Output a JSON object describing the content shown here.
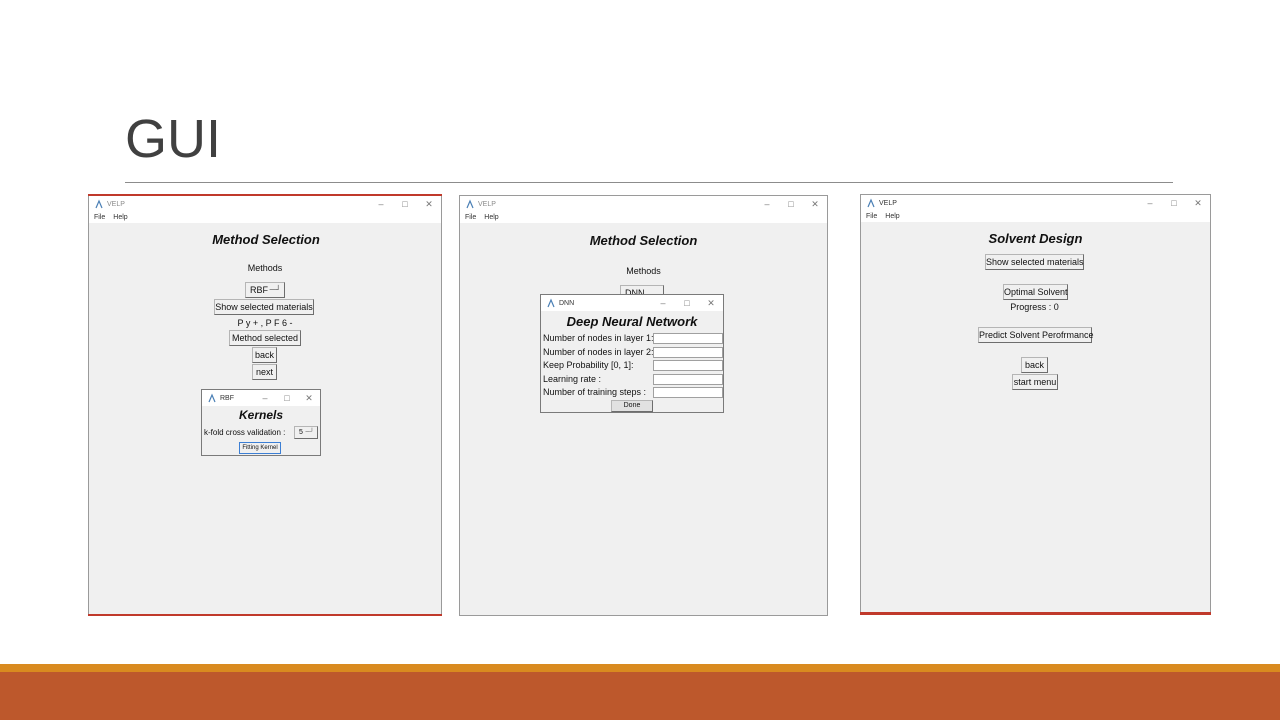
{
  "slide": {
    "title": "GUI"
  },
  "colors": {
    "band_orange": "#d98a1f",
    "band_rust": "#bd582c",
    "window_bg": "#f0f0f0"
  },
  "icons": {
    "app": "feather-icon",
    "minimize": "minimize-icon",
    "maximize": "maximize-icon",
    "close": "close-icon"
  },
  "window1": {
    "title": "VELP",
    "menu": [
      "File",
      "Help"
    ],
    "heading": "Method Selection",
    "methods_label": "Methods",
    "method_value": "RBF",
    "show_materials_button": "Show selected materials",
    "materials_text": "P y + , P F 6 -",
    "method_selected_button": "Method selected",
    "back_button": "back",
    "next_button": "next",
    "dialog": {
      "title": "RBF",
      "heading": "Kernels",
      "kfold_label": "k-fold cross validation :",
      "kfold_value": "5",
      "fit_button": "Fitting Kernel"
    }
  },
  "window2": {
    "title": "VELP",
    "menu": [
      "File",
      "Help"
    ],
    "heading": "Method Selection",
    "methods_label": "Methods",
    "method_value": "DNN",
    "dialog": {
      "title": "DNN",
      "heading": "Deep Neural Network",
      "fields": [
        {
          "label": "Number of nodes in layer 1:",
          "value": ""
        },
        {
          "label": "Number of nodes in layer 2:",
          "value": ""
        },
        {
          "label": "Keep Probability [0, 1]:",
          "value": ""
        },
        {
          "label": "Learning rate :",
          "value": ""
        },
        {
          "label": "Number of training steps :",
          "value": ""
        }
      ],
      "done_button": "Done"
    }
  },
  "window3": {
    "title": "VELP",
    "menu": [
      "File",
      "Help"
    ],
    "heading": "Solvent Design",
    "show_materials_button": "Show selected materials",
    "optimal_button": "Optimal Solvent",
    "progress_text": "Progress : 0",
    "predict_button": "Predict Solvent Perofrmance",
    "back_button": "back",
    "start_menu_button": "start menu"
  }
}
